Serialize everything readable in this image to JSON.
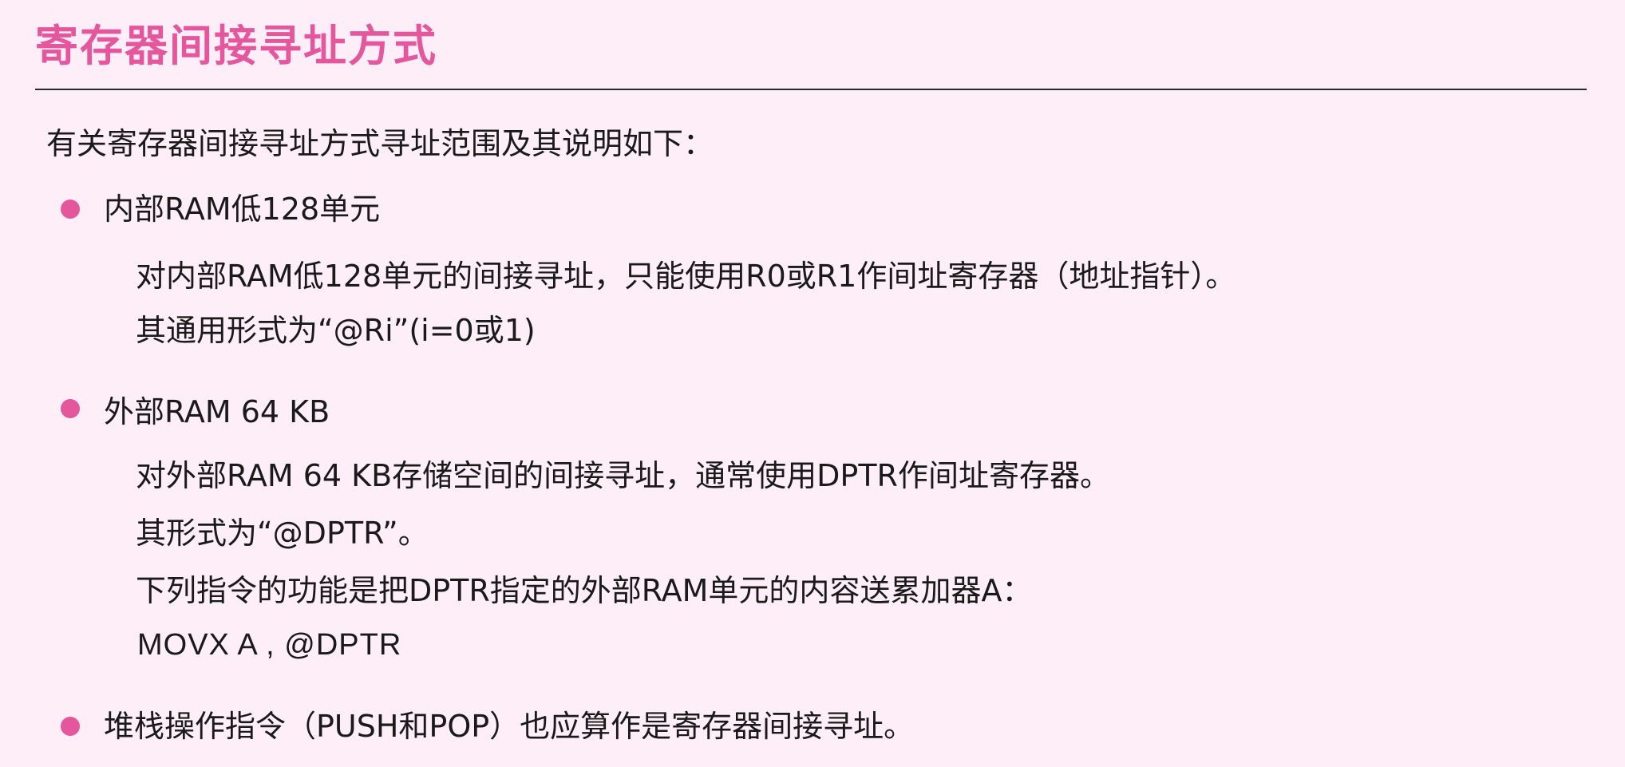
{
  "slide": {
    "title": "寄存器间接寻址方式",
    "intro": "有关寄存器间接寻址方式寻址范围及其说明如下：",
    "bullets": [
      {
        "heading": "内部RAM低128单元",
        "lines": [
          "对内部RAM低128单元的间接寻址，只能使用R0或R1作间址寄存器（地址指针）。",
          "其通用形式为“@Ri”(i=0或1)"
        ]
      },
      {
        "heading": "外部RAM 64 KB",
        "lines": [
          "对外部RAM 64 KB存储空间的间接寻址，通常使用DPTR作间址寄存器。",
          "其形式为“@DPTR”。",
          "下列指令的功能是把DPTR指定的外部RAM单元的内容送累加器A："
        ],
        "code": "MOVX  A , @DPTR"
      },
      {
        "heading": "堆栈操作指令（PUSH和POP）也应算作是寄存器间接寻址。"
      }
    ]
  },
  "colors": {
    "background": "#fdeef8",
    "accent": "#e5579d",
    "text": "#1a1a1a",
    "rule": "#2a2a2a"
  }
}
